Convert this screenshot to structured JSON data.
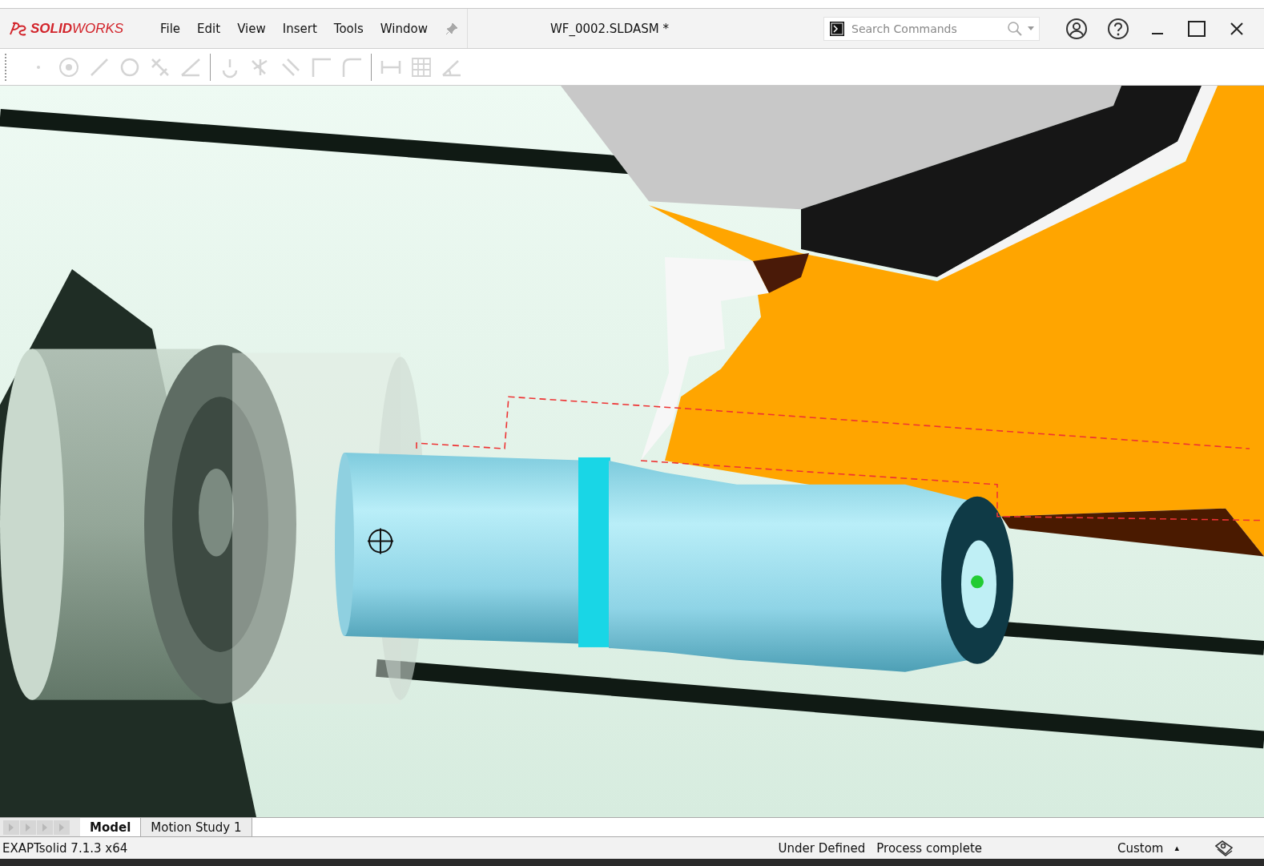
{
  "app": {
    "logo_brand": "SOLID",
    "logo_suffix": "WORKS"
  },
  "menu": [
    {
      "label": "File"
    },
    {
      "label": "Edit"
    },
    {
      "label": "View"
    },
    {
      "label": "Insert"
    },
    {
      "label": "Tools"
    },
    {
      "label": "Window"
    }
  ],
  "window": {
    "title": "WF_0002.SLDASM *"
  },
  "search": {
    "placeholder": "Search Commands"
  },
  "toolbar": {
    "disabled": true
  },
  "tabs": [
    {
      "label": "Model",
      "selected": true
    },
    {
      "label": "Motion Study 1",
      "selected": false
    }
  ],
  "status_bar": {
    "version": "EXAPTsolid 7.1.3 x64",
    "definition": "Under Defined",
    "process": "Process complete",
    "units": "Custom",
    "units_arrow": "▴"
  }
}
